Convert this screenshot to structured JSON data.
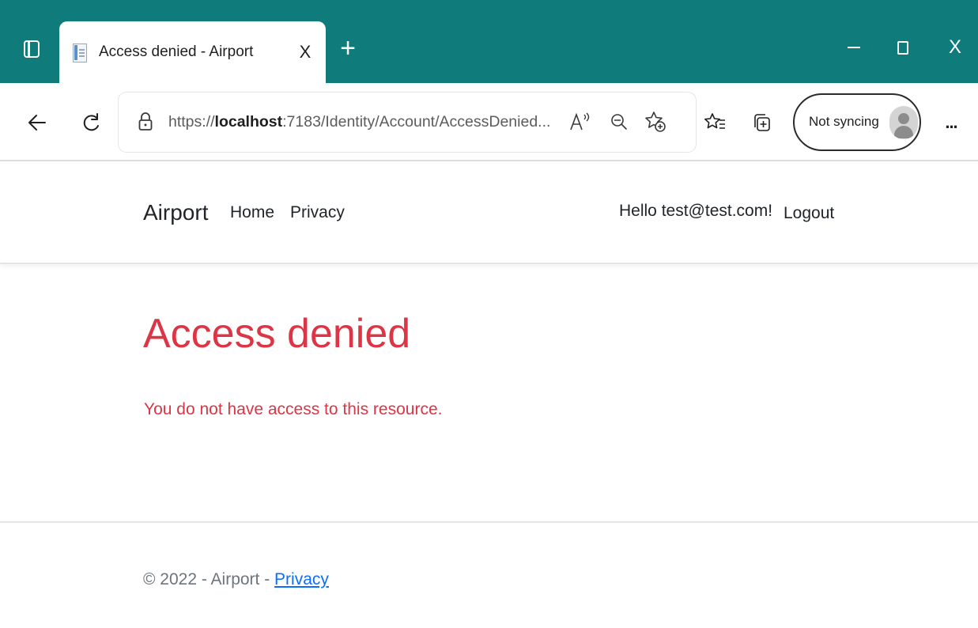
{
  "browser": {
    "tab": {
      "title": "Access denied - Airport",
      "close_glyph": "X"
    },
    "new_tab_glyph": "+",
    "window": {
      "close_glyph": "X"
    },
    "address": {
      "scheme": "https://",
      "host": "localhost",
      "rest": ":7183/Identity/Account/AccessDenied..."
    },
    "profile": {
      "label": "Not syncing"
    },
    "more_glyph": "..."
  },
  "site": {
    "brand": "Airport",
    "nav": {
      "home": "Home",
      "privacy": "Privacy"
    },
    "user": {
      "greeting": "Hello test@test.com!",
      "logout": "Logout"
    }
  },
  "main": {
    "heading": "Access denied",
    "message": "You do not have access to this resource."
  },
  "footer": {
    "copyright": "© 2022 - Airport - ",
    "privacy_link": "Privacy"
  },
  "colors": {
    "titlebar": "#0f7b7b",
    "error": "#dc3545",
    "link": "#0d6efd"
  }
}
